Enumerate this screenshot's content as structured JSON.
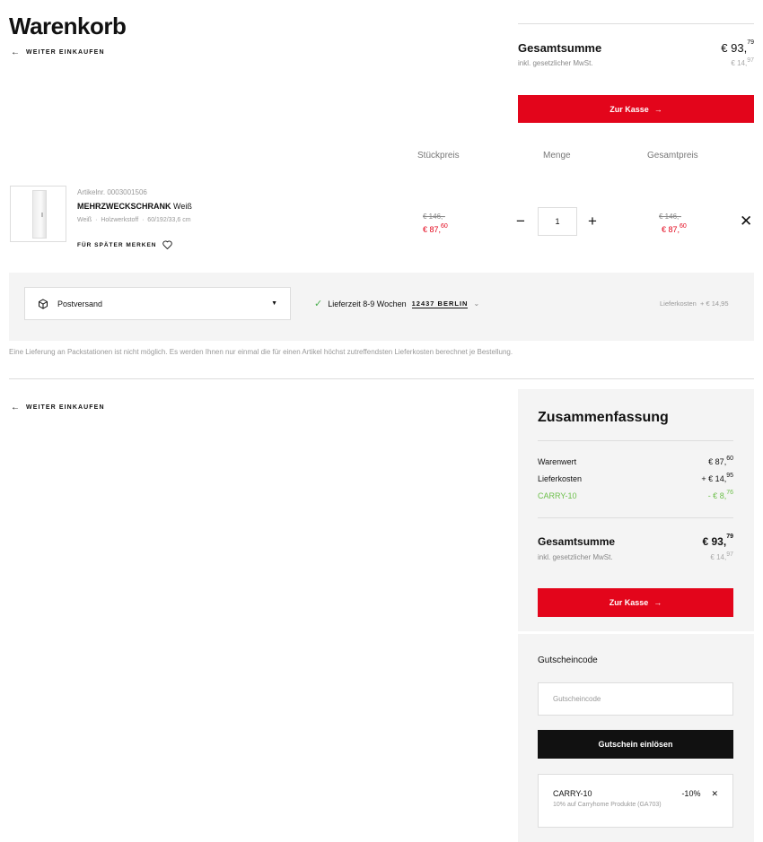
{
  "header": {
    "title": "Warenkorb",
    "back_label": "WEITER EINKAUFEN"
  },
  "top_summary": {
    "total_label": "Gesamtsumme",
    "total_main": "€ 93,",
    "total_cents": "79",
    "vat_label": "inkl. gesetzlicher MwSt.",
    "vat_main": "€ 14,",
    "vat_cents": "97",
    "checkout_label": "Zur Kasse"
  },
  "columns": {
    "unit_price": "Stückpreis",
    "quantity": "Menge",
    "total_price": "Gesamtpreis"
  },
  "item": {
    "article_no": "Artikelnr. 0003001506",
    "name_bold": "MEHRZWECKSCHRANK",
    "name_rest": " Weiß",
    "attributes": "Weiß  ·  Holzwerkstoff  ·  60/192/33,6 cm",
    "save_later": "FÜR SPÄTER MERKEN",
    "unit_old": "€ 146,-",
    "unit_new_main": "€ 87,",
    "unit_new_cents": "60",
    "qty": "1",
    "total_old": "€ 146,-",
    "total_new_main": "€ 87,",
    "total_new_cents": "60"
  },
  "shipping": {
    "method": "Postversand",
    "delivery_time": "Lieferzeit 8-9 Wochen",
    "zip_city": "12437 BERLIN",
    "cost": "Lieferkosten  + € 14,95",
    "notice": "Eine Lieferung an Packstationen ist nicht möglich. Es werden Ihnen nur einmal die für einen Artikel höchst zutreffendsten Lieferkosten berechnet je Bestellung."
  },
  "summary": {
    "title": "Zusammenfassung",
    "goods_label": "Warenwert",
    "goods_main": "€ 87,",
    "goods_cents": "60",
    "delivery_label": "Lieferkosten",
    "delivery_main": "+ € 14,",
    "delivery_cents": "95",
    "discount_label": "CARRY-10",
    "discount_main": "- € 8,",
    "discount_cents": "76",
    "total_label": "Gesamtsumme",
    "total_main": "€ 93,",
    "total_cents": "79",
    "vat_label": "inkl. gesetzlicher MwSt.",
    "vat_main": "€ 14,",
    "vat_cents": "97",
    "checkout_label": "Zur Kasse"
  },
  "voucher": {
    "title": "Gutscheincode",
    "placeholder": "Gutscheincode",
    "button_label": "Gutschein einlösen",
    "applied_code": "CARRY-10",
    "applied_percent": "-10%",
    "applied_desc": "10% auf Carryhome Produkte (GA703)"
  },
  "colors": {
    "accent": "#e3051b",
    "discount": "#6cbf4a",
    "panel": "#f4f4f4"
  }
}
